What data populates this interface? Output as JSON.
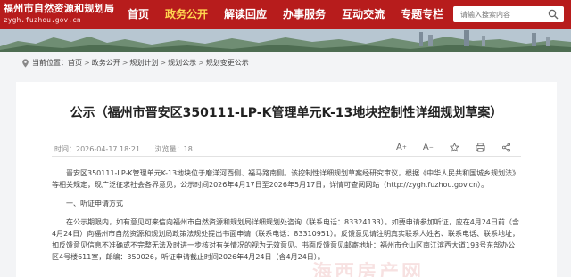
{
  "header": {
    "site_name": "福州市自然资源和规划局",
    "site_domain": "zygh.fuzhou.gov.cn",
    "nav": [
      {
        "label": "首页"
      },
      {
        "label": "政务公开"
      },
      {
        "label": "解读回应"
      },
      {
        "label": "办事服务"
      },
      {
        "label": "互动交流"
      },
      {
        "label": "专题专栏"
      }
    ],
    "active_nav": "政务公开",
    "accent_color": "#b71c1c",
    "search": {
      "placeholder": "请输入搜索内容",
      "icon": "search-icon"
    }
  },
  "breadcrumb": {
    "prefix": "当前位置：",
    "items": [
      "首页",
      "政务公开",
      "规划计划",
      "规划公示",
      "规划变更公示"
    ],
    "separator": ">"
  },
  "article": {
    "title": "公示（福州市晋安区350111-LP-K管理单元K-13地块控制性详细规划草案）",
    "time_label": "时间：",
    "time": "2026-04-17 18:21",
    "views_label": "浏览量：",
    "views": "18",
    "tools": {
      "font_up": "A",
      "font_down": "A",
      "favorite_icon": "star-icon",
      "print_icon": "print-icon",
      "share_icon": "share-icon"
    },
    "paragraphs": [
      "晋安区350111-LP-K管理单元K-13地块位于磨洋河西侧、福马路南侧。该控制性详细规划草案经研究审议，根据《中华人民共和国城乡规划法》等相关规定，现广泛征求社会各界意见，公示时间2026年4月17日至2026年5月17日，详情可查阅网站（http://zygh.fuzhou.gov.cn）。",
      "一、听证申请方式",
      "在公示期限内，如有意见可来信向福州市自然资源和规划局详细规划处咨询（联系电话：83324133）。如要申请参加听证，应在4月24日前（含4月24日）向福州市自然资源和规划局政策法规处提出书面申请（联系电话：83310951）。反馈意见请注明真实联系人姓名、联系电话、联系地址，如反馈意见信息不准确或不完整无法及时进一步核对有关情况的视为无效意见。书面反馈意见邮寄地址：福州市仓山区南江滨西大道193号东部办公区4号楼611室，邮编：350026，听证申请截止时间2026年4月24日（含4月24日）。"
    ]
  },
  "watermark": "海西房产网"
}
